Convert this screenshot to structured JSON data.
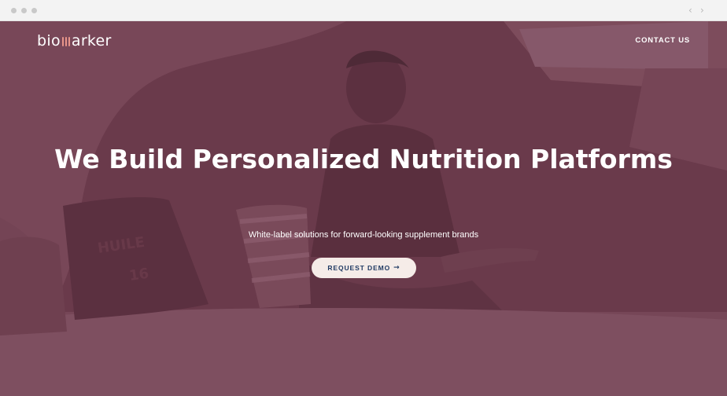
{
  "browser": {
    "back_icon": "chevron-left-icon",
    "forward_icon": "chevron-right-icon"
  },
  "header": {
    "logo_prefix": "bio",
    "logo_suffix": "arker",
    "contact_label": "CONTACT US"
  },
  "hero": {
    "title": "We Build Personalized Nutrition Platforms",
    "subtitle": "White-label solutions for forward-looking supplement brands",
    "cta_label": "REQUEST DEMO",
    "cta_arrow": "→"
  },
  "colors": {
    "overlay": "#6b3a4c",
    "accent": "#e8958a",
    "cta_bg": "#f5ece8",
    "cta_text": "#203a63"
  }
}
